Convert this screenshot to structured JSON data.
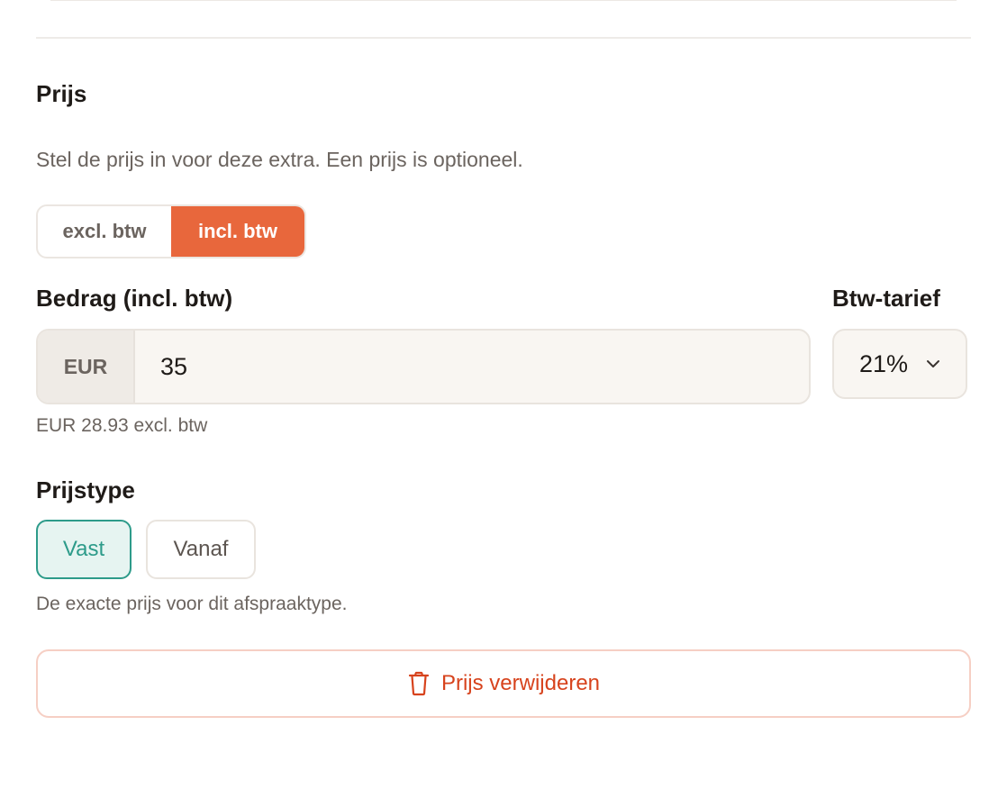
{
  "price_section": {
    "title": "Prijs",
    "description": "Stel de prijs in voor deze extra. Een prijs is optioneel.",
    "vat_mode": {
      "options": [
        "excl. btw",
        "incl. btw"
      ],
      "selected": "incl. btw"
    },
    "amount": {
      "label": "Bedrag (incl. btw)",
      "currency": "EUR",
      "value": "35",
      "hint": "EUR 28.93 excl. btw"
    },
    "vat_rate": {
      "label": "Btw-tarief",
      "value": "21%"
    },
    "price_type": {
      "label": "Prijstype",
      "options": [
        "Vast",
        "Vanaf"
      ],
      "selected": "Vast",
      "hint": "De exacte prijs voor dit afspraaktype."
    },
    "remove_button": {
      "label": "Prijs verwijderen"
    }
  },
  "colors": {
    "accent": "#e8673c",
    "teal": "#2d9b8a",
    "danger": "#d7431d"
  }
}
